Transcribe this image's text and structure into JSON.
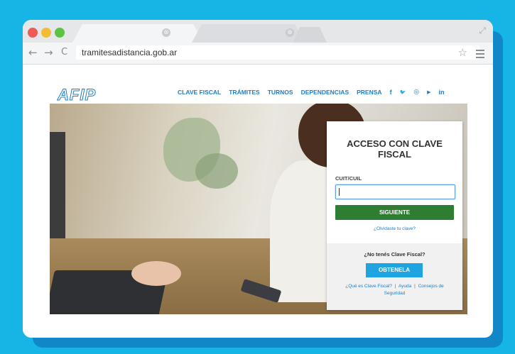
{
  "browser": {
    "tabs": [
      {
        "close": "⊗"
      },
      {
        "close": "⊗"
      }
    ],
    "url": "tramitesadistancia.gob.ar",
    "back": "←",
    "forward": "→",
    "reload": "C",
    "star": "☆",
    "expand": "⤢"
  },
  "site": {
    "logo": "AFIP",
    "nav": [
      "CLAVE FISCAL",
      "TRÁMITES",
      "TURNOS",
      "DEPENDENCIAS",
      "PRENSA"
    ],
    "social": [
      "f",
      "🐦",
      "◎",
      "▶",
      "in"
    ]
  },
  "login": {
    "title_line1": "ACCESO CON CLAVE",
    "title_line2": "FISCAL",
    "cuit_label": "CUIT/CUIL",
    "cuit_value": "",
    "next_button": "SIGUIENTE",
    "forgot_link": "¿Olvidaste tu clave?",
    "no_key_question": "¿No tenés Clave Fiscal?",
    "get_button": "OBTENELA",
    "link_what": "¿Qué es Clave Fiscal?",
    "link_help": "Ayuda",
    "link_security": "Consejos de Seguridad",
    "separator": "|"
  },
  "colors": {
    "background": "#17b4e6",
    "brand_blue": "#1f7ec7",
    "next_green": "#2e7d32",
    "get_blue": "#1ea4e0"
  }
}
